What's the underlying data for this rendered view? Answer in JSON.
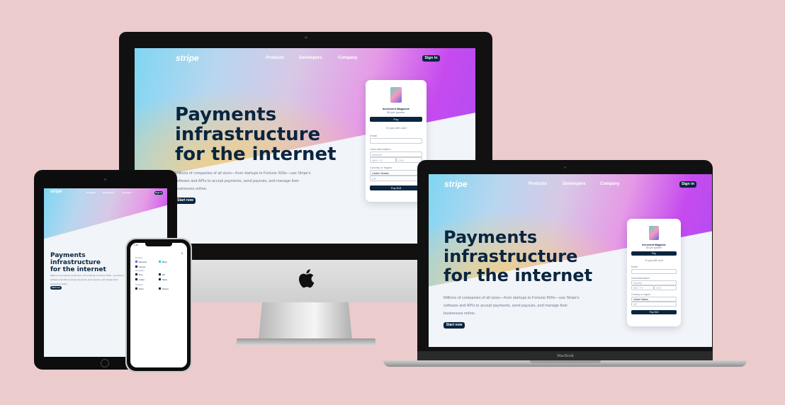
{
  "site": {
    "logo": "stripe",
    "nav": [
      "Products",
      "Developers",
      "Company"
    ],
    "signin": "Sign in",
    "headline": [
      "Payments",
      "infrastructure",
      "for the internet"
    ],
    "description": "Millions of companies of all sizes—from startups to Fortune 500s—use Stripe's software and APIs to accept payments, send payouts, and manage their businesses online.",
    "description_lines": [
      "Millions of companies of all sizes—from startups to Fortune 500s—use Stripe's",
      "software and APIs to accept payments, send payouts, and manage their",
      "businesses online."
    ],
    "cta": "Start now"
  },
  "checkout": {
    "product_name": "Increment Magazine",
    "product_price": "$6 per quarter",
    "pay_button": "Pay",
    "or_text": "Or pay with card",
    "email_label": "Email",
    "card_label": "Card information",
    "card_number_placeholder": "Number",
    "expiry_placeholder": "MM / YY",
    "cvc_placeholder": "CVC",
    "country_label": "Country or region",
    "country_value": "United States",
    "zip_placeholder": "ZIP",
    "submit": "Pay $18"
  },
  "laptop": {
    "brand": "MacBook"
  },
  "phone": {
    "time": "1:49",
    "groups": [
      {
        "title": "Products",
        "items": [
          "Payments",
          "Billing",
          "Connect",
          "Radar"
        ]
      },
      {
        "title": "Developers",
        "items": [
          "Docs",
          "API",
          "Guides",
          "Status"
        ]
      },
      {
        "title": "Company",
        "items": [
          "About",
          "Careers"
        ]
      }
    ]
  },
  "colors": {
    "background": "#eccbcc",
    "navy": "#0a2540",
    "accent_purple": "#c74bef"
  }
}
